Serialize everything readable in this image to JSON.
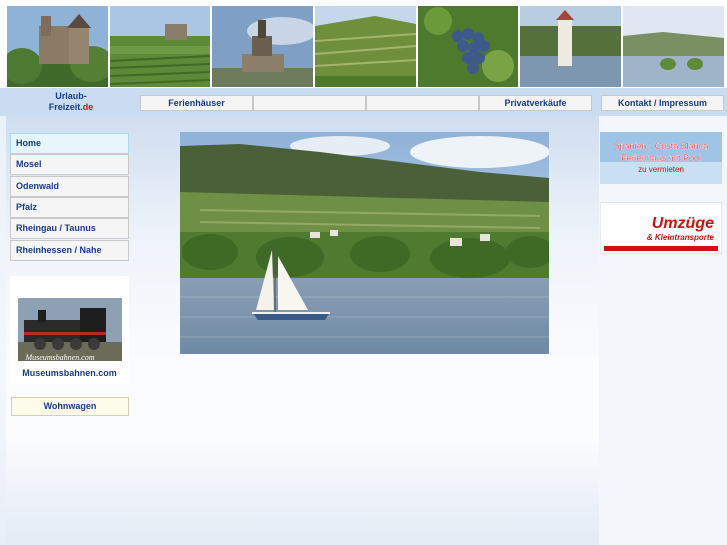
{
  "logo": {
    "line1": "Urlaub-",
    "line2": "Freizeit",
    "tld": ".de"
  },
  "nav": {
    "ferienhaeuser": "Ferienhäuser",
    "empty1": "",
    "empty2": "",
    "privatverkaeufe": "Privatverkäufe",
    "kontakt": "Kontakt / Impressum"
  },
  "sidebar": {
    "items": [
      {
        "label": "Home"
      },
      {
        "label": "Mosel"
      },
      {
        "label": "Odenwald"
      },
      {
        "label": "Pfalz"
      },
      {
        "label": "Rheingau / Taunus"
      },
      {
        "label": "Rheinhessen / Nahe"
      }
    ],
    "ad_image_caption": "Museumsbahnen.com",
    "ad_label": "Museumsbahnen.com",
    "wohnwagen": "Wohnwagen"
  },
  "banners": {
    "spanien": {
      "line1": "Spanien - Costa Blanca",
      "line2": "Ferienhaus mit Pool",
      "line3": "zu vermieten"
    },
    "umzuege": {
      "line1": "Umzüge",
      "line2": "& Kleintransporte"
    }
  },
  "colors": {
    "link": "#1a3a8a",
    "accent_red": "#d01010",
    "nav_bg": "#c9dcf2"
  },
  "photo_strip": [
    "castle-photo",
    "vineyard-castle-photo",
    "monument-photo",
    "vineyard-hill-photo",
    "grapes-photo",
    "tower-river-photo",
    "river-village-photo"
  ]
}
